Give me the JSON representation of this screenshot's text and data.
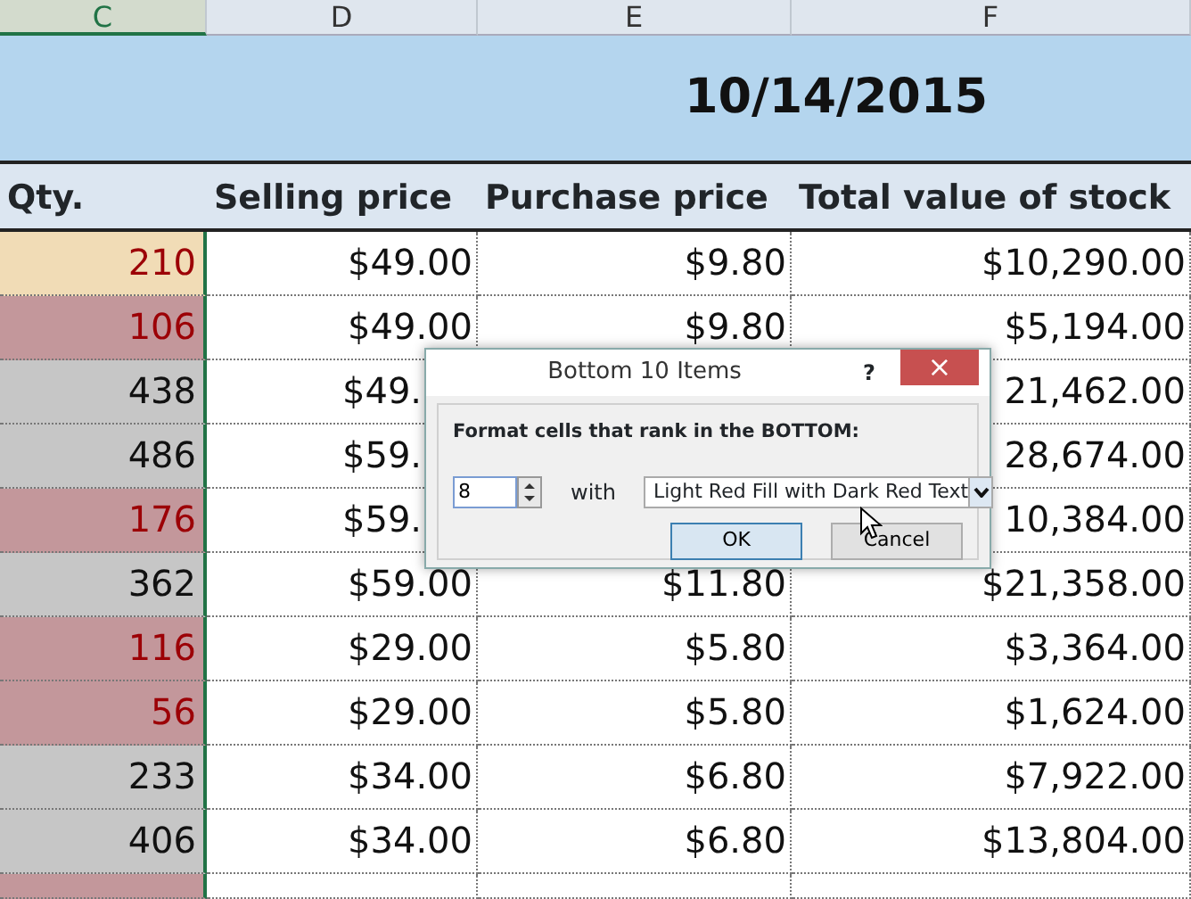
{
  "column_headers": [
    {
      "label": "C",
      "selected": true
    },
    {
      "label": "D",
      "selected": false
    },
    {
      "label": "E",
      "selected": false
    },
    {
      "label": "F",
      "selected": false
    }
  ],
  "date": "10/14/2015",
  "table": {
    "columns": [
      "Qty.",
      "Selling price",
      "Purchase price",
      "Total value of stock"
    ],
    "rows": [
      {
        "cells": [
          {
            "text": "210",
            "color": "#f1dcb6",
            "dark_red_text": true
          },
          {
            "text": "$49.00"
          },
          {
            "text": "$9.80"
          },
          {
            "text": "$10,290.00"
          }
        ]
      },
      {
        "cells": [
          {
            "text": "106",
            "color": "#c3979b",
            "dark_red_text": true
          },
          {
            "text": "$49.00"
          },
          {
            "text": "$9.80"
          },
          {
            "text": "$5,194.00"
          }
        ]
      },
      {
        "cells": [
          {
            "text": "438",
            "color": "#c6c6c6",
            "dark_red_text": false
          },
          {
            "text": "$49.",
            "cut": true
          },
          {},
          {
            "text": "21,462.00"
          }
        ]
      },
      {
        "cells": [
          {
            "text": "486",
            "color": "#c6c6c6",
            "dark_red_text": false
          },
          {
            "text": "$59.",
            "cut": true
          },
          {},
          {
            "text": "28,674.00"
          }
        ]
      },
      {
        "cells": [
          {
            "text": "176",
            "color": "#c3979b",
            "dark_red_text": true
          },
          {
            "text": "$59.",
            "cut": true
          },
          {},
          {
            "text": "10,384.00"
          }
        ]
      },
      {
        "cells": [
          {
            "text": "362",
            "color": "#c6c6c6",
            "dark_red_text": false
          },
          {
            "text": "$59.00"
          },
          {
            "text": "$11.80"
          },
          {
            "text": "$21,358.00"
          }
        ]
      },
      {
        "cells": [
          {
            "text": "116",
            "color": "#c3979b",
            "dark_red_text": true
          },
          {
            "text": "$29.00"
          },
          {
            "text": "$5.80"
          },
          {
            "text": "$3,364.00"
          }
        ]
      },
      {
        "cells": [
          {
            "text": "56",
            "color": "#c3979b",
            "dark_red_text": true
          },
          {
            "text": "$29.00"
          },
          {
            "text": "$5.80"
          },
          {
            "text": "$1,624.00"
          }
        ]
      },
      {
        "cells": [
          {
            "text": "233",
            "color": "#c6c6c6",
            "dark_red_text": false
          },
          {
            "text": "$34.00"
          },
          {
            "text": "$6.80"
          },
          {
            "text": "$7,922.00"
          }
        ]
      },
      {
        "cells": [
          {
            "text": "406",
            "color": "#c6c6c6",
            "dark_red_text": false
          },
          {
            "text": "$34.00"
          },
          {
            "text": "$6.80"
          },
          {
            "text": "$13,804.00"
          }
        ]
      },
      {
        "cells": [
          {
            "color": "#c3979b"
          },
          {},
          {},
          {}
        ]
      }
    ]
  },
  "dialog": {
    "title": "Bottom 10 Items",
    "help": "?",
    "close": "×",
    "prompt": "Format cells that rank in the BOTTOM:",
    "count": "8",
    "with_label": "with",
    "format": "Light Red Fill with Dark Red Text",
    "buttons": [
      "OK",
      "Cancel"
    ]
  }
}
